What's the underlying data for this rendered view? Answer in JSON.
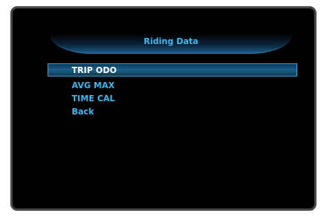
{
  "header": {
    "title": "Riding Data"
  },
  "menu": {
    "items": [
      {
        "label": "TRIP ODO",
        "selected": true
      },
      {
        "label": "AVG MAX",
        "selected": false
      },
      {
        "label": "TIME CAL",
        "selected": false
      },
      {
        "label": "Back",
        "selected": false
      }
    ]
  },
  "colors": {
    "accent": "#36b9f2",
    "selection_fill": "#1a5f8e",
    "selection_border": "#2fa8e6",
    "background": "#000000",
    "bezel": "#4a4a4a"
  }
}
